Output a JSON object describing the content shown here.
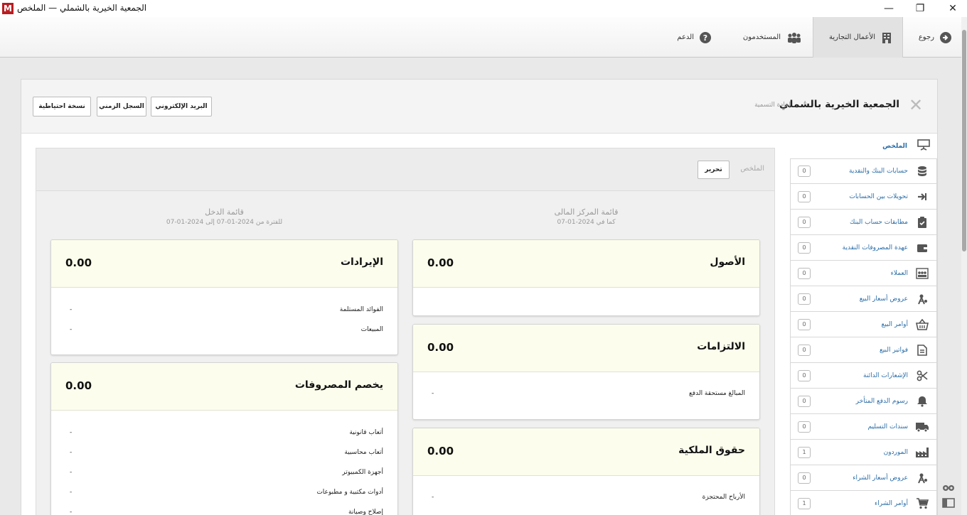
{
  "window": {
    "title": "الجمعية الخيرية بالشملي — الملخص",
    "logo": "M",
    "controls": {
      "minimize": "—",
      "maximize": "❐",
      "close": "✕"
    }
  },
  "nav": {
    "back": "رجوع",
    "business": "الأعمال التجارية",
    "users": "المستخدمون",
    "support": "الدعم"
  },
  "header": {
    "business_name": "الجمعية الخيرية بالشملي",
    "rename": "إعادة التسمية",
    "buttons": {
      "email": "البريد الإلكتروني",
      "timeline": "السجل الزمني",
      "backup": "نسخة احتياطية"
    }
  },
  "sidebar": {
    "summary": "الملخص",
    "items": [
      {
        "label": "حسابات البنك والنقدية",
        "count": "0",
        "icon": "database-icon"
      },
      {
        "label": "تحويلات بين الحسابات",
        "count": "0",
        "icon": "transfer-icon"
      },
      {
        "label": "مطابقات حساب البنك",
        "count": "0",
        "icon": "clipboard-check-icon"
      },
      {
        "label": "عهدة المصروفات النقدية",
        "count": "0",
        "icon": "wallet-icon"
      },
      {
        "label": "العملاء",
        "count": "0",
        "icon": "customers-icon"
      },
      {
        "label": "عروض أسعار البيع",
        "count": "0",
        "icon": "quote-icon"
      },
      {
        "label": "أوامر البيع",
        "count": "0",
        "icon": "basket-icon"
      },
      {
        "label": "فواتير البيع",
        "count": "0",
        "icon": "invoice-icon"
      },
      {
        "label": "الإشعارات الدائنة",
        "count": "0",
        "icon": "scissors-icon"
      },
      {
        "label": "رسوم الدفع المتأخر",
        "count": "0",
        "icon": "bell-icon"
      },
      {
        "label": "سندات التسليم",
        "count": "0",
        "icon": "truck-icon"
      },
      {
        "label": "الموردون",
        "count": "1",
        "icon": "factory-icon"
      },
      {
        "label": "عروض أسعار الشراء",
        "count": "0",
        "icon": "quote-icon"
      },
      {
        "label": "أوامر الشراء",
        "count": "1",
        "icon": "cart-icon"
      }
    ]
  },
  "summary": {
    "label": "الملخص",
    "edit": "تحرير",
    "balance_sheet": {
      "title": "قائمة المركز المالى",
      "subtitle": "كما في 2024-01-07"
    },
    "income_statement": {
      "title": "قائمة الدخل",
      "subtitle": "للفترة من 2024-01-07 إلى 2024-01-07"
    },
    "cards": {
      "assets": {
        "title": "الأصول",
        "total": "0.00"
      },
      "liabilities": {
        "title": "الالتزامات",
        "total": "0.00",
        "rows": [
          {
            "label": "المبالغ مستحقة الدفع",
            "value": "-"
          }
        ]
      },
      "equity": {
        "title": "حقوق الملكية",
        "total": "0.00",
        "rows": [
          {
            "label": "الأرباح المحتجزة",
            "value": "-"
          }
        ]
      },
      "income": {
        "title": "الإيرادات",
        "total": "0.00",
        "rows": [
          {
            "label": "الفوائد المستلمة",
            "value": "-"
          },
          {
            "label": "المبيعات",
            "value": "-"
          }
        ]
      },
      "expenses": {
        "title": "يخصم المصروفات",
        "total": "0.00",
        "rows": [
          {
            "label": "أتعاب قانونية",
            "value": "-"
          },
          {
            "label": "أتعاب محاسبية",
            "value": "-"
          },
          {
            "label": "أجهزة الكمبيوتر",
            "value": "-"
          },
          {
            "label": "أدوات مكتبية و مطبوعات",
            "value": "-"
          },
          {
            "label": "إصلاح وصيانة",
            "value": "-"
          }
        ]
      }
    }
  },
  "colors": {
    "link": "#2b6ea8",
    "card_head": "#fcfdec",
    "logo": "#b81d22"
  }
}
